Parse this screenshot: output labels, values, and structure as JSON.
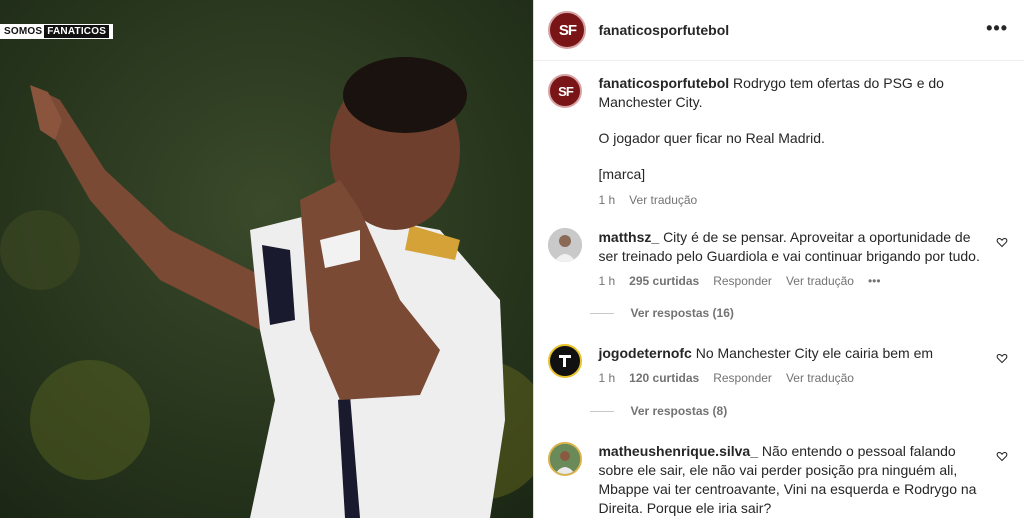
{
  "watermark": {
    "part1": "SOMOS",
    "part2": "FANATICOS"
  },
  "header": {
    "username": "fanaticosporfutebol",
    "logo_text": "SF",
    "more_label": "•••"
  },
  "caption": {
    "username": "fanaticosporfutebol",
    "line1": "Rodrygo tem ofertas do PSG e do Manchester City.",
    "line2": "O jogador quer ficar no Real Madrid.",
    "line3": "[marca]",
    "time": "1 h",
    "translate": "Ver tradução"
  },
  "comments": [
    {
      "username": "matthsz_",
      "text": "City é de se pensar. Aproveitar a oportunidade de ser treinado pelo Guardiola e vai continuar brigando por tudo.",
      "time": "1 h",
      "likes": "295 curtidas",
      "reply": "Responder",
      "translate": "Ver tradução",
      "more": "•••",
      "view_replies": "Ver respostas (16)"
    },
    {
      "username": "jogodeternofc",
      "text": "No Manchester City ele cairia bem em",
      "time": "1 h",
      "likes": "120 curtidas",
      "reply": "Responder",
      "translate": "Ver tradução",
      "view_replies": "Ver respostas (8)"
    },
    {
      "username": "matheushenrique.silva_",
      "text": "Não entendo o pessoal falando sobre ele sair, ele não vai perder posição pra ninguém ali, Mbappe vai ter centroavante, Vini na esquerda e Rodrygo na Direita. Porque ele iria sair?"
    }
  ],
  "colors": {
    "brand": "#7a1517",
    "muted": "#737373",
    "text": "#262626"
  }
}
